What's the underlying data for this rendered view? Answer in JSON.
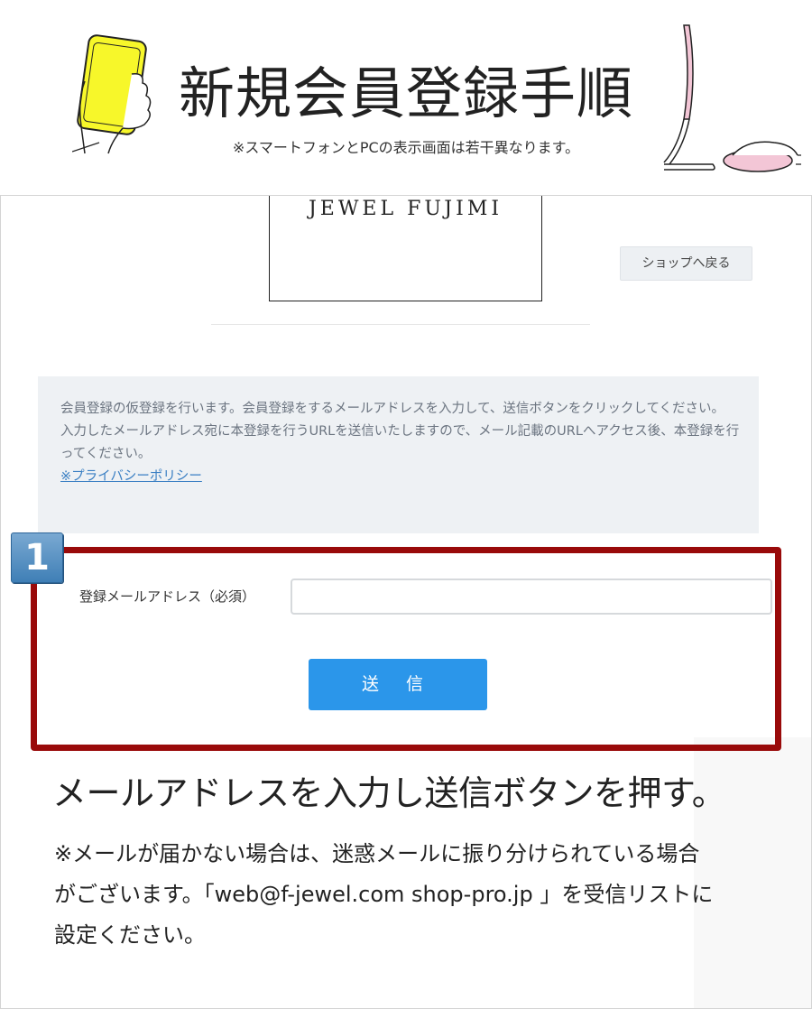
{
  "header": {
    "title": "新規会員登録手順",
    "subtitle": "※スマートフォンとPCの表示画面は若干異なります。"
  },
  "shop": {
    "logo_text": "JEWEL FUJIMI",
    "back_button_label": "ショップへ戻る"
  },
  "notice": {
    "line1": "会員登録の仮登録を行います。会員登録をするメールアドレスを入力して、送信ボタンをクリックしてください。",
    "line2": "入力したメールアドレス宛に本登録を行うURLを送信いたしますので、メール記載のURLへアクセス後、本登録を行ってください。",
    "privacy_link": "※プライバシーポリシー"
  },
  "step": {
    "number": "1"
  },
  "form": {
    "email_label": "登録メールアドレス（必須）",
    "email_value": "",
    "email_placeholder": "",
    "submit_label": "送 信"
  },
  "instruction": {
    "main": "メールアドレスを入力し送信ボタンを押す。",
    "note_line1": "※メールが届かない場合は、迷惑メールに振り分けられている場合",
    "note_line2": "がございます。「web@f-jewel.com shop-pro.jp 」を受信リストに",
    "note_line3": "設定ください。"
  },
  "colors": {
    "highlight_border": "#990a0a",
    "submit_button": "#2b96ea",
    "notice_background": "#eef1f4",
    "phone_screen": "#f7f72a",
    "pc_accent": "#f3c6d6"
  },
  "icons": {
    "phone": "smartphone-in-hand-icon",
    "pc": "desktop-pc-mouse-icon"
  }
}
